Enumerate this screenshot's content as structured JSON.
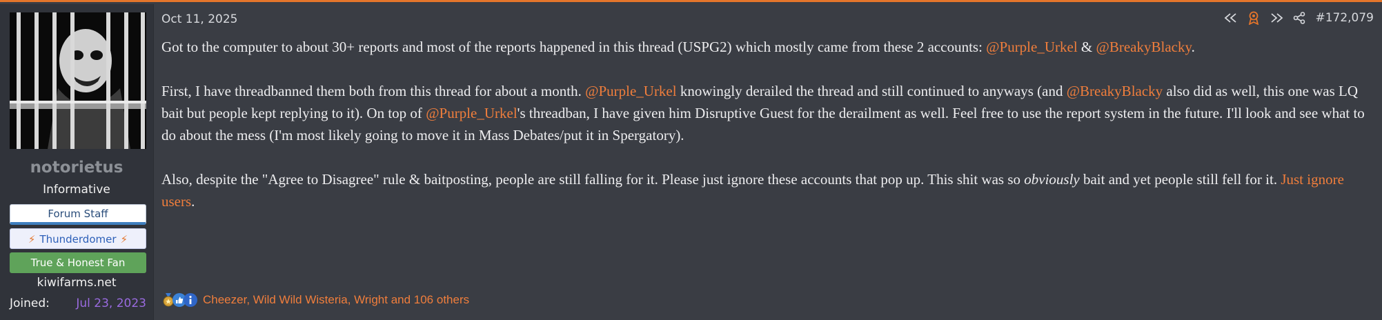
{
  "user": {
    "name": "notorietus",
    "title": "Informative",
    "banners": [
      "Forum Staff",
      "Thunderdomer",
      "True & Honest Fan"
    ],
    "site": "kiwifarms.net",
    "joined_label": "Joined:",
    "joined_value": "Jul 23, 2023"
  },
  "post": {
    "date": "Oct 11, 2025",
    "number": "#172,079",
    "p1": {
      "t1": "Got to the computer to about 30+ reports and most of the reports happened in this thread (USPG2) which mostly came from these 2 accounts: ",
      "m1": "@Purple_Urkel",
      "t2": " & ",
      "m2": "@BreakyBlacky",
      "t3": "."
    },
    "p2": {
      "t1": "First, I have threadbanned them both from this thread for about a month. ",
      "m1": "@Purple_Urkel",
      "t2": " knowingly derailed the thread and still continued to anyways (and ",
      "m2": "@BreakyBlacky",
      "t3": " also did as well, this one was LQ bait but people kept replying to it). On top of ",
      "m3": "@Purple_Urkel",
      "t4": "'s threadban, I have given him Disruptive Guest for the derailment as well. Feel free to use the report system in the future. I'll look and see what to do about the mess (I'm most likely going to move it in Mass Debates/put it in Spergatory)."
    },
    "p3": {
      "t1": "Also, despite the \"Agree to Disagree\" rule & baitposting, people are still falling for it. Please just ignore these accounts that pop up. This shit was so ",
      "em": "obviously",
      "t2": " bait and yet people still fell for it. ",
      "link": "Just ignore users",
      "t3": "."
    },
    "reactions_text": "Cheezer, Wild Wild Wisteria, Wright and 106 others"
  },
  "icons": {
    "first_post": "rewind-icon",
    "award": "award-ribbon-icon",
    "next_post": "fast-forward-icon",
    "share": "share-icon",
    "reaction_1": "medal-reaction-icon",
    "reaction_2": "thumbs-up-reaction-icon",
    "reaction_3": "informative-reaction-icon"
  },
  "colors": {
    "accent": "#e4752b",
    "mention": "#f07e3c",
    "joined_date": "#9a6be0",
    "fan_banner": "#5fa35a"
  }
}
